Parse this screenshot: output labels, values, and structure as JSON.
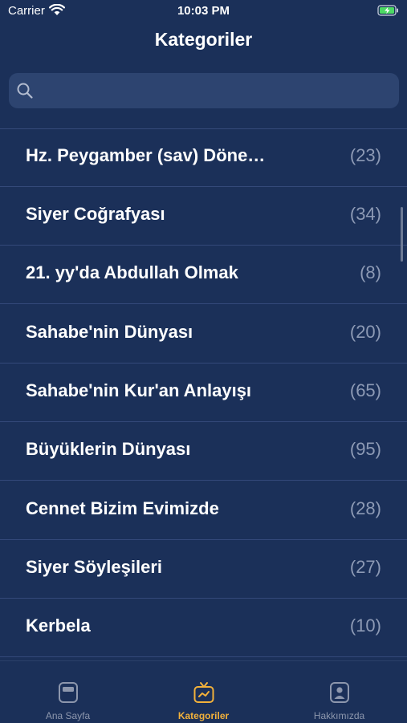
{
  "status_bar": {
    "carrier": "Carrier",
    "time": "10:03 PM"
  },
  "nav": {
    "title": "Kategoriler"
  },
  "search": {
    "placeholder": "",
    "value": ""
  },
  "categories": [
    {
      "title": "Hz. Peygamber (sav) Döne…",
      "count": "(23)"
    },
    {
      "title": "Siyer Coğrafyası",
      "count": "(34)"
    },
    {
      "title": "21. yy'da Abdullah Olmak",
      "count": "(8)"
    },
    {
      "title": "Sahabe'nin Dünyası",
      "count": "(20)"
    },
    {
      "title": "Sahabe'nin Kur'an Anlayışı",
      "count": "(65)"
    },
    {
      "title": "Büyüklerin Dünyası",
      "count": "(95)"
    },
    {
      "title": "Cennet Bizim Evimizde",
      "count": "(28)"
    },
    {
      "title": "Siyer Söyleşileri",
      "count": "(27)"
    },
    {
      "title": "Kerbela",
      "count": "(10)"
    }
  ],
  "tab_bar": {
    "tabs": [
      {
        "label": "Ana Sayfa",
        "icon": "home-card-icon",
        "active": false
      },
      {
        "label": "Kategoriler",
        "icon": "tv-icon",
        "active": true
      },
      {
        "label": "Hakkımızda",
        "icon": "person-card-icon",
        "active": false
      }
    ]
  },
  "colors": {
    "background": "#1b3059",
    "search_field": "#2d4470",
    "separator": "#34497a",
    "count_text": "#8d9ab5",
    "tab_inactive": "#8d97ad",
    "tab_active": "#f2b13b",
    "battery_charging": "#4cd964"
  }
}
